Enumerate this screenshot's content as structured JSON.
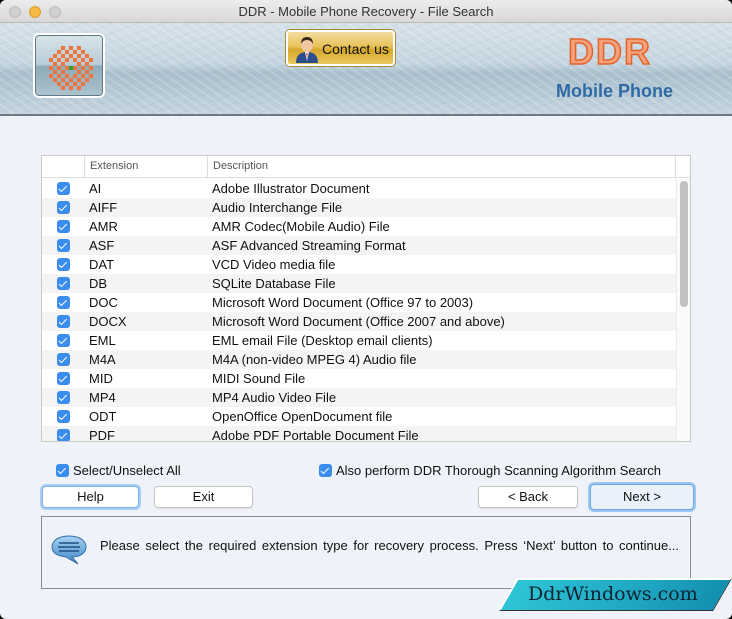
{
  "window": {
    "title": "DDR - Mobile Phone Recovery - File Search"
  },
  "banner": {
    "contact_label": "Contact us",
    "brand_title": "DDR",
    "brand_subtitle": "Mobile Phone",
    "colors": {
      "brand_orange": "#e2642c",
      "brand_blue": "#2f6aa4"
    }
  },
  "table": {
    "columns": [
      "",
      "Extension",
      "Description"
    ],
    "rows": [
      {
        "checked": true,
        "ext": "AI",
        "desc": "Adobe Illustrator Document"
      },
      {
        "checked": true,
        "ext": "AIFF",
        "desc": "Audio Interchange File"
      },
      {
        "checked": true,
        "ext": "AMR",
        "desc": "AMR Codec(Mobile Audio) File"
      },
      {
        "checked": true,
        "ext": "ASF",
        "desc": "ASF Advanced Streaming Format"
      },
      {
        "checked": true,
        "ext": "DAT",
        "desc": "VCD Video media file"
      },
      {
        "checked": true,
        "ext": "DB",
        "desc": "SQLite Database File"
      },
      {
        "checked": true,
        "ext": "DOC",
        "desc": "Microsoft Word Document (Office 97 to 2003)"
      },
      {
        "checked": true,
        "ext": "DOCX",
        "desc": "Microsoft Word Document (Office 2007 and above)"
      },
      {
        "checked": true,
        "ext": "EML",
        "desc": "EML email File (Desktop email clients)"
      },
      {
        "checked": true,
        "ext": "M4A",
        "desc": "M4A (non-video MPEG 4) Audio file"
      },
      {
        "checked": true,
        "ext": "MID",
        "desc": "MIDI Sound File"
      },
      {
        "checked": true,
        "ext": "MP4",
        "desc": "MP4 Audio Video File"
      },
      {
        "checked": true,
        "ext": "ODT",
        "desc": "OpenOffice OpenDocument file"
      },
      {
        "checked": true,
        "ext": "PDF",
        "desc": "Adobe PDF Portable Document File"
      }
    ]
  },
  "options": {
    "select_all_label": "Select/Unselect All",
    "select_all_checked": true,
    "thorough_label": "Also perform DDR Thorough Scanning Algorithm Search",
    "thorough_checked": true
  },
  "buttons": {
    "help": "Help",
    "exit": "Exit",
    "back": "< Back",
    "next": "Next >"
  },
  "info": {
    "message": "Please select the required extension type for recovery process. Press ‘Next’ button to continue..."
  },
  "watermark": {
    "text": "DdrWindows.com"
  },
  "colors": {
    "checkbox_accent": "#3b8ded",
    "window_bg": "#eff2f8"
  }
}
